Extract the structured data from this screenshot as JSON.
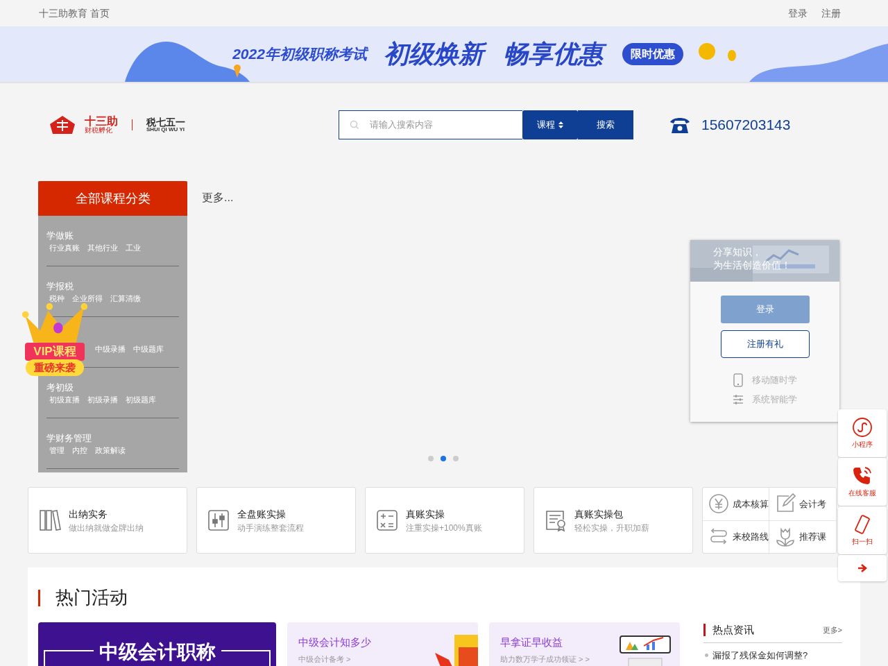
{
  "top_bar": {
    "site": "十三助教育 首页",
    "links": [
      "登录",
      "注册"
    ]
  },
  "promo_banner": {
    "headline": "2022年初级职称考试",
    "slogans": [
      "初级焕新",
      "畅享优惠"
    ],
    "badge": "限时优惠"
  },
  "header": {
    "logo": {
      "brand": "十三助",
      "tagline": "财税孵化",
      "partner": "税七五一",
      "partner_pinyin": "SHUI QI WU YI"
    },
    "search": {
      "placeholder": "请输入搜索内容",
      "scope": "课程",
      "button": "搜索"
    },
    "phone": "15607203143"
  },
  "categories": {
    "title": "全部课程分类",
    "groups": [
      {
        "title": "学做账",
        "links": [
          "行业真账",
          "其他行业",
          "工业"
        ]
      },
      {
        "title": "学报税",
        "links": [
          "税种",
          "企业所得",
          "汇算清缴"
        ]
      },
      {
        "links": [
          "中级录播",
          "中级题库"
        ]
      },
      {
        "title": "考初级",
        "links": [
          "初级直播",
          "初级录播",
          "初级题库"
        ]
      },
      {
        "title": "学财务管理",
        "links": [
          "管理",
          "内控",
          "政策解读"
        ]
      }
    ]
  },
  "vip_badge": {
    "title": "VIP课程",
    "subtitle": "重磅来袭"
  },
  "more_link": "更多...",
  "login_card": {
    "slogan": [
      "分享知识，",
      "为生活创造价值！"
    ],
    "login": "登录",
    "register": "注册有礼",
    "features": [
      {
        "kind": "phone",
        "label": "移动随时学"
      },
      {
        "kind": "sliders",
        "label": "系统智能学"
      }
    ]
  },
  "carousel_dots": [
    {
      "selected": false
    },
    {
      "selected": true
    },
    {
      "selected": false
    }
  ],
  "feature_cards": [
    {
      "kind": "binders",
      "title": "出纳实务",
      "subtitle": "做出纳就做金牌出纳"
    },
    {
      "kind": "sliders",
      "title": "全盘账实操",
      "subtitle": "动手演练整套流程"
    },
    {
      "kind": "calculator",
      "title": "真账实操",
      "subtitle": "注重实操+100%真账"
    },
    {
      "kind": "certificate",
      "title": "真账实操包",
      "subtitle": "轻松实操，升职加薪"
    }
  ],
  "quick_links": [
    {
      "kind": "yen",
      "label": "成本核算"
    },
    {
      "kind": "edit",
      "label": "会计考"
    },
    {
      "kind": "route",
      "label": "来校路线"
    },
    {
      "kind": "flower",
      "label": "推荐课"
    }
  ],
  "side_tools": [
    {
      "kind": "miniapp",
      "label": "小程序"
    },
    {
      "kind": "phone",
      "label": "在线客服"
    },
    {
      "kind": "mobile",
      "label": "扫一扫"
    },
    {
      "kind": "arrow"
    }
  ],
  "hot_activities": {
    "title": "热门活动",
    "feature_banner": "中级会计职称",
    "cards": [
      {
        "kind": "ticket",
        "title": "中级会计知多少",
        "subtitle": "中级会计备考 >"
      },
      {
        "kind": "chart",
        "title": "早拿证早收益",
        "subtitle": "助力数万学子成功领证 > >"
      }
    ],
    "news": {
      "title": "热点资讯",
      "more": "更多>",
      "items": [
        "漏报了残保金如何调整?"
      ]
    }
  }
}
